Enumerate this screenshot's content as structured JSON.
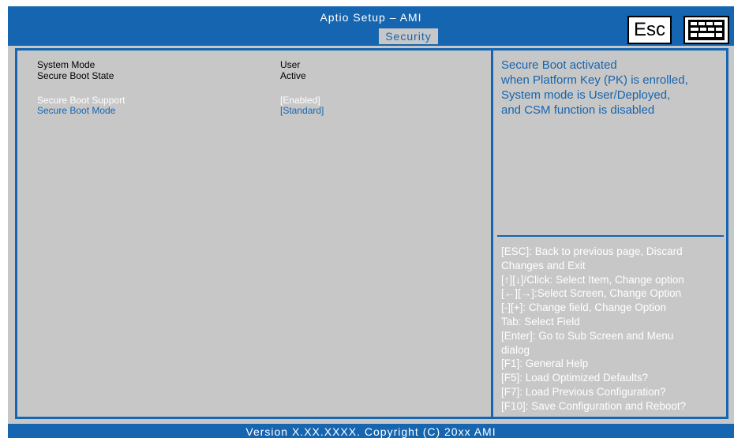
{
  "header": {
    "title": "Aptio Setup  –  AMI",
    "active_tab": "Security",
    "esc_label": "Esc"
  },
  "main": {
    "info_rows": [
      {
        "label": "System Mode",
        "value": "User"
      },
      {
        "label": "Secure Boot State",
        "value": "Active"
      }
    ],
    "option_rows": [
      {
        "label": "Secure Boot Support",
        "value": "[Enabled]",
        "state": "selected"
      },
      {
        "label": "Secure Boot Mode",
        "value": "[Standard]",
        "state": "normal"
      }
    ]
  },
  "help": {
    "description_lines": [
      "Secure Boot activated",
      "when Platform Key (PK) is enrolled,",
      "System mode is User/Deployed,",
      "and CSM function is disabled"
    ],
    "key_lines": [
      "[ESC]: Back to previous page, Discard",
      "Changes and Exit",
      "[↑][↓]/Click: Select Item, Change option",
      "[←][→]:Select Screen, Change Option",
      "[-][+]: Change field, Change Option",
      "Tab: Select Field",
      "[Enter]: Go to Sub Screen and Menu",
      "dialog",
      "[F1]: General Help",
      "[F5]: Load Optimized Defaults?",
      "[F7]: Load Previous Configuration?",
      "[F10]: Save Configuration and Reboot?"
    ]
  },
  "footer": {
    "version_text": "Version X.XX.XXXX. Copyright (C) 20xx AMI"
  },
  "colors": {
    "accent_blue": "#1565b0",
    "panel_gray": "#c7c7c7",
    "selected_text": "#ffffff"
  },
  "icons": [
    "esc-key-icon",
    "keyboard-icon"
  ]
}
